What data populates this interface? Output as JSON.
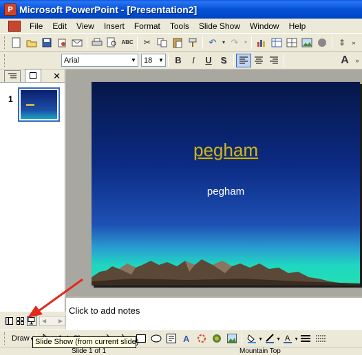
{
  "window": {
    "title": "Microsoft PowerPoint - [Presentation2]",
    "icon": "powerpoint-app-icon"
  },
  "menu": {
    "items": [
      "File",
      "Edit",
      "View",
      "Insert",
      "Format",
      "Tools",
      "Slide Show",
      "Window",
      "Help"
    ]
  },
  "formatting": {
    "font": "Arial",
    "size": "18"
  },
  "left_pane": {
    "slide_number": "1"
  },
  "slide": {
    "title": "pegham",
    "subtitle": "pegham",
    "design": "Mountain Top"
  },
  "notes": {
    "placeholder": "Click to add notes"
  },
  "draw_toolbar": {
    "draw_label": "Draw",
    "autoshapes_label": "AutoShapes"
  },
  "tooltip": {
    "text": "Slide Show (from current slide)"
  },
  "status": {
    "slide_info": "Slide 1 of 1",
    "design_name": "Mountain Top"
  },
  "colors": {
    "title_bar": "#0552d8",
    "slide_title": "#c8b236",
    "annotation_arrow": "#e22a1a"
  }
}
